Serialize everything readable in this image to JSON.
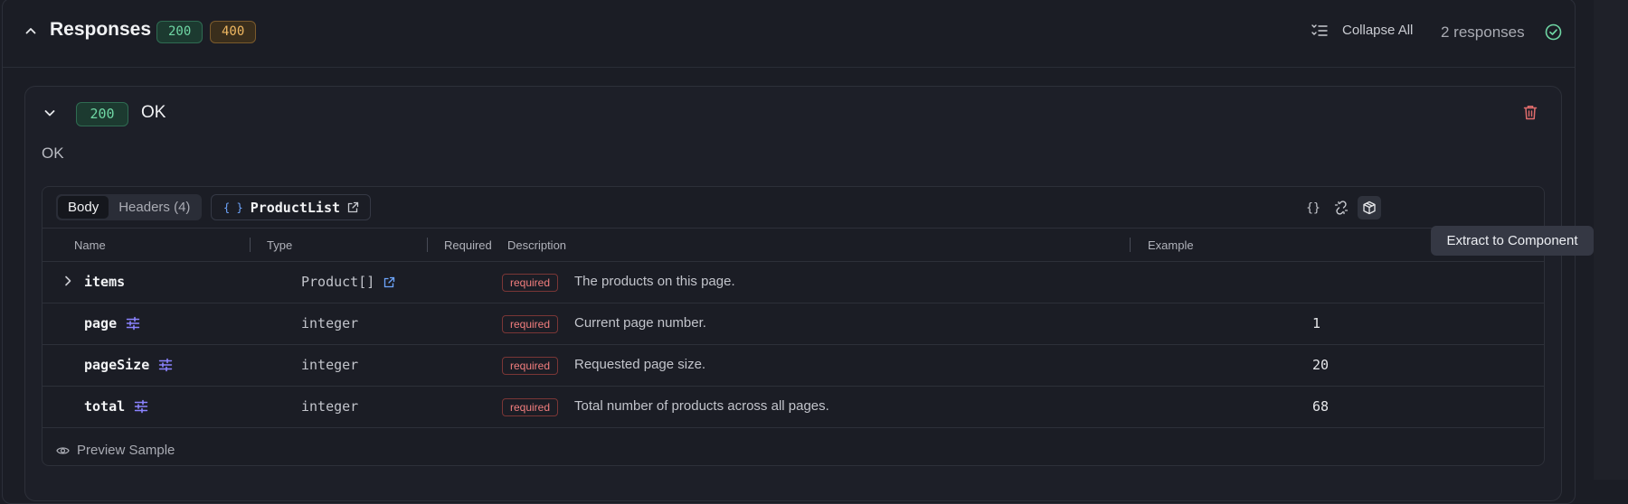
{
  "header": {
    "title": "Responses",
    "badges": [
      "200",
      "400"
    ],
    "collapse_label": "Collapse All",
    "count_label": "2 responses"
  },
  "response": {
    "status": "200",
    "title": "OK",
    "description": "OK",
    "tabs": [
      {
        "label": "Body",
        "active": true
      },
      {
        "label": "Headers (4)",
        "active": false
      }
    ],
    "schema_ref": "ProductList",
    "tools": [
      "braces-icon",
      "unlink-icon",
      "package-icon"
    ],
    "columns": {
      "name": "Name",
      "type": "Type",
      "required": "Required",
      "description": "Description",
      "example": "Example"
    },
    "rows": [
      {
        "name": "items",
        "type": "Product[]",
        "required": "required",
        "description": "The products on this page.",
        "example": ""
      },
      {
        "name": "page",
        "type": "integer",
        "required": "required",
        "description": "Current page number.",
        "example": "1"
      },
      {
        "name": "pageSize",
        "type": "integer",
        "required": "required",
        "description": "Requested page size.",
        "example": "20"
      },
      {
        "name": "total",
        "type": "integer",
        "required": "required",
        "description": "Total number of products across all pages.",
        "example": "68"
      }
    ],
    "preview_label": "Preview Sample"
  },
  "tooltip": "Extract to Component",
  "colors": {
    "background": "#1b1d25",
    "success": "#6fd6a4",
    "warning": "#f0b862",
    "danger": "#f27e7e",
    "link": "#6ea6ff",
    "constraint_icon": "#8b83ff"
  }
}
